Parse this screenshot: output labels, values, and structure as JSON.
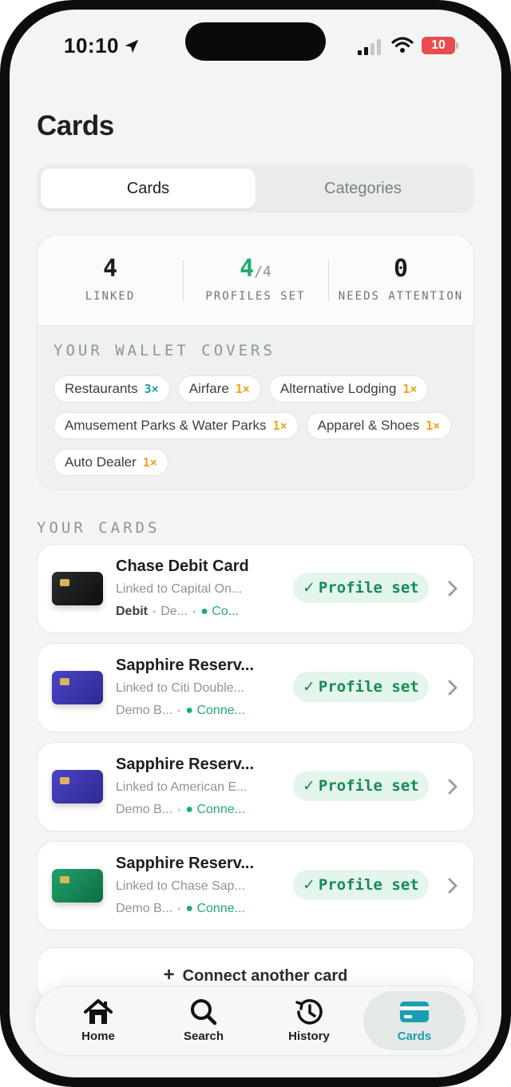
{
  "status_bar": {
    "time": "10:10",
    "battery": "10"
  },
  "page": {
    "title": "Cards"
  },
  "segments": [
    {
      "label": "Cards",
      "active": true
    },
    {
      "label": "Categories",
      "active": false
    }
  ],
  "summary": {
    "stats": [
      {
        "value": "4",
        "label": "LINKED"
      },
      {
        "value": "4",
        "denominator": "/4",
        "label": "PROFILES SET"
      },
      {
        "value": "0",
        "label": "NEEDS ATTENTION"
      }
    ],
    "covers_title": "YOUR WALLET COVERS",
    "chips": [
      {
        "label": "Restaurants",
        "multiplier": "3×",
        "color": "#1a9fb0"
      },
      {
        "label": "Airfare",
        "multiplier": "1×",
        "color": "#f0a21c"
      },
      {
        "label": "Alternative Lodging",
        "multiplier": "1×",
        "color": "#f0a21c"
      },
      {
        "label": "Amusement Parks & Water Parks",
        "multiplier": "1×",
        "color": "#f0a21c"
      },
      {
        "label": "Apparel & Shoes",
        "multiplier": "1×",
        "color": "#f0a21c"
      },
      {
        "label": "Auto Dealer",
        "multiplier": "1×",
        "color": "#f0a21c"
      }
    ]
  },
  "cards_section_title": "YOUR CARDS",
  "cards": [
    {
      "name": "Chase Debit Card",
      "linked": "Linked to Capital On...",
      "type": "Debit",
      "bank": "De...",
      "status": "Co...",
      "badge": "Profile set",
      "art_color": "black"
    },
    {
      "name": "Sapphire Reserv...",
      "linked": "Linked to Citi Double...",
      "type": "",
      "bank": "Demo B...",
      "status": "Conne...",
      "badge": "Profile set",
      "art_color": "purple"
    },
    {
      "name": "Sapphire Reserv...",
      "linked": "Linked to American E...",
      "type": "",
      "bank": "Demo B...",
      "status": "Conne...",
      "badge": "Profile set",
      "art_color": "purple"
    },
    {
      "name": "Sapphire Reserv...",
      "linked": "Linked to Chase Sap...",
      "type": "",
      "bank": "Demo B...",
      "status": "Conne...",
      "badge": "Profile set",
      "art_color": "green"
    }
  ],
  "connect_button": {
    "label": "Connect another card"
  },
  "tabs": [
    {
      "label": "Home",
      "icon": "home-icon"
    },
    {
      "label": "Search",
      "icon": "search-icon"
    },
    {
      "label": "History",
      "icon": "history-icon"
    },
    {
      "label": "Cards",
      "icon": "card-icon",
      "active": true
    }
  ],
  "colors": {
    "accent_green": "#1fae6b",
    "accent_teal": "#1a9fb0",
    "multiplier_orange": "#f0a21c"
  }
}
